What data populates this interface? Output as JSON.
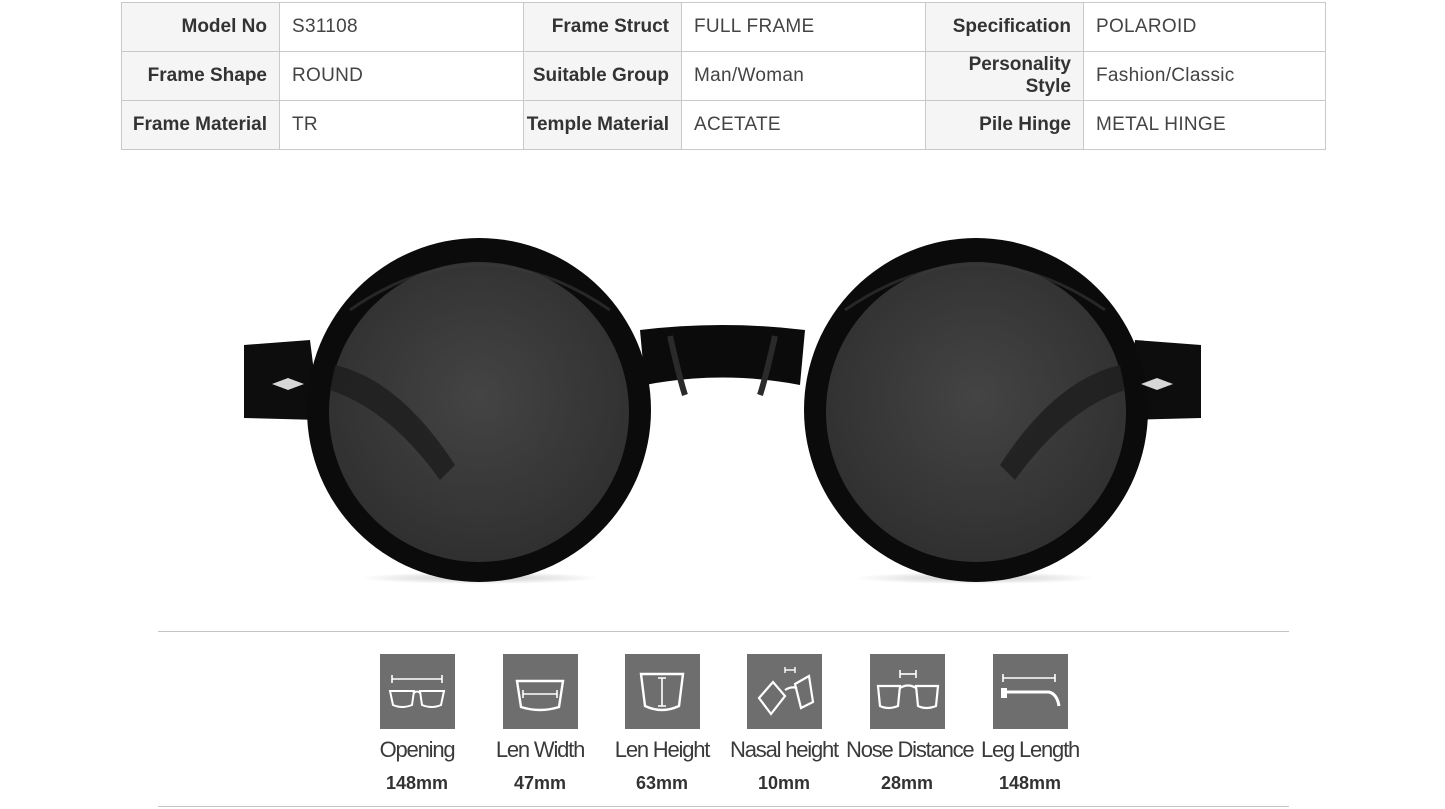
{
  "specs": {
    "rows": [
      [
        {
          "label": "Model No",
          "value": "S31108"
        },
        {
          "label": "Frame Struct",
          "value": "FULL FRAME"
        },
        {
          "label": "Specification",
          "value": "POLAROID"
        }
      ],
      [
        {
          "label": "Frame Shape",
          "value": "ROUND"
        },
        {
          "label": "Suitable Group",
          "value": "Man/Woman"
        },
        {
          "label": "Personality Style",
          "value": "Fashion/Classic"
        }
      ],
      [
        {
          "label": "Frame Material",
          "value": "TR"
        },
        {
          "label": "Temple Material",
          "value": "ACETATE"
        },
        {
          "label": "Pile Hinge",
          "value": "METAL HINGE"
        }
      ]
    ]
  },
  "measurements": [
    {
      "label": "Opening",
      "value": "148mm",
      "icon": "opening-icon"
    },
    {
      "label": "Len Width",
      "value": "47mm",
      "icon": "lens-width-icon"
    },
    {
      "label": "Len Height",
      "value": "63mm",
      "icon": "lens-height-icon"
    },
    {
      "label": "Nasal height",
      "value": "10mm",
      "icon": "nasal-height-icon"
    },
    {
      "label": "Nose Distance",
      "value": "28mm",
      "icon": "nose-distance-icon"
    },
    {
      "label": "Leg Length",
      "value": "148mm",
      "icon": "leg-length-icon"
    }
  ],
  "colors": {
    "label_bg": "#f5f5f5",
    "border": "#c9c9c9",
    "icon_box": "#6e6e6e",
    "frame": "#0b0b0b",
    "lens": "#3a3a3a"
  }
}
